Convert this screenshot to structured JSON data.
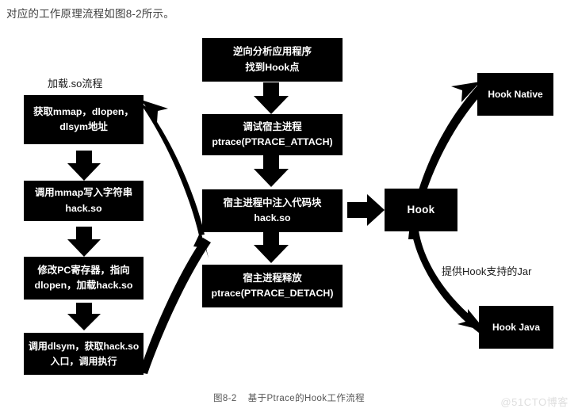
{
  "page": {
    "intro_text": "对应的工作原理流程如图8-2所示。",
    "caption_number": "图8-2",
    "caption_title": "基于Ptrace的Hook工作流程",
    "watermark": "@51CTO博客",
    "background_color": "#ffffff",
    "node_fill": "#000000",
    "node_text_color": "#ffffff"
  },
  "labels": {
    "load_so_flow": "加载.so流程",
    "provide_jar": "提供Hook支持的Jar"
  },
  "left_column": {
    "title": "加载.so流程",
    "nodes": [
      {
        "line1": "获取mmap，dlopen，",
        "line2": "dlsym地址"
      },
      {
        "line1": "调用mmap写入字符串",
        "line2": "hack.so"
      },
      {
        "line1": "修改PC寄存器，指向",
        "line2": "dlopen，加载hack.so"
      },
      {
        "line1": "调用dlsym，获取hack.so",
        "line2": "入口，调用执行"
      }
    ]
  },
  "center_column": {
    "nodes": [
      {
        "line1": "逆向分析应用程序",
        "line2": "找到Hook点"
      },
      {
        "line1": "调试宿主进程",
        "line2": "ptrace(PTRACE_ATTACH)"
      },
      {
        "line1": "宿主进程中注入代码块",
        "line2": "hack.so"
      },
      {
        "line1": "宿主进程释放",
        "line2": "ptrace(PTRACE_DETACH)"
      }
    ]
  },
  "right_column": {
    "hook": "Hook",
    "hook_native": "Hook Native",
    "hook_java": "Hook Java"
  },
  "connectors": [
    {
      "name": "left-1-to-2",
      "type": "block-arrow-down"
    },
    {
      "name": "left-2-to-3",
      "type": "block-arrow-down"
    },
    {
      "name": "left-3-to-4",
      "type": "block-arrow-down"
    },
    {
      "name": "center-1-to-2",
      "type": "block-arrow-down"
    },
    {
      "name": "center-2-to-3",
      "type": "block-arrow-down"
    },
    {
      "name": "center-3-to-4",
      "type": "block-arrow-down"
    },
    {
      "name": "inject-to-hook",
      "type": "block-arrow-right"
    },
    {
      "name": "inject-to-load-so",
      "type": "curved-arrow"
    },
    {
      "name": "dlsym-back-to-inject",
      "type": "curved-arrow"
    },
    {
      "name": "hook-to-hook-native",
      "type": "curved-arrow"
    },
    {
      "name": "hook-to-hook-java",
      "type": "curved-arrow"
    }
  ]
}
